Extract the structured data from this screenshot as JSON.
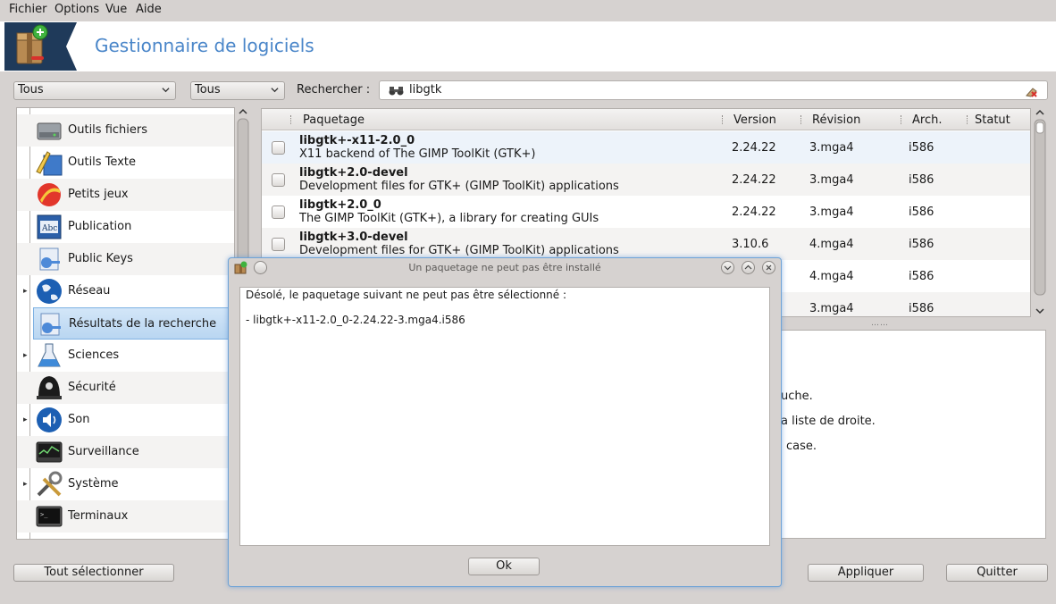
{
  "menubar": {
    "items": [
      "Fichier",
      "Options",
      "Vue",
      "Aide"
    ]
  },
  "banner": {
    "title": "Gestionnaire de logiciels"
  },
  "filters": {
    "combo1": "Tous",
    "combo2": "Tous",
    "search_label": "Rechercher :",
    "search_value": "libgtk"
  },
  "categories": [
    {
      "label": "Outils fichiers",
      "icon": "harddisk-icon",
      "expander": false
    },
    {
      "label": "Outils Texte",
      "icon": "text-tools-icon",
      "expander": false
    },
    {
      "label": "Petits jeux",
      "icon": "ball-icon",
      "expander": false
    },
    {
      "label": "Publication",
      "icon": "book-abc-icon",
      "expander": false
    },
    {
      "label": "Public Keys",
      "icon": "public-keys-icon",
      "expander": false
    },
    {
      "label": "Réseau",
      "icon": "globe-icon",
      "expander": true
    },
    {
      "label": "Résultats de la recherche",
      "icon": "search-results-icon",
      "expander": false,
      "selected": true
    },
    {
      "label": "Sciences",
      "icon": "flask-icon",
      "expander": true
    },
    {
      "label": "Sécurité",
      "icon": "police-helmet-icon",
      "expander": false
    },
    {
      "label": "Son",
      "icon": "speaker-icon",
      "expander": true
    },
    {
      "label": "Surveillance",
      "icon": "monitor-graph-icon",
      "expander": false
    },
    {
      "label": "Système",
      "icon": "tools-icon",
      "expander": true
    },
    {
      "label": "Terminaux",
      "icon": "terminal-icon",
      "expander": false
    }
  ],
  "packages": {
    "columns": {
      "name": "Paquetage",
      "version": "Version",
      "release": "Révision",
      "arch": "Arch.",
      "status": "Statut"
    },
    "rows": [
      {
        "name": "libgtk+-x11-2.0_0",
        "desc": "X11 backend of The GIMP ToolKit (GTK+)",
        "version": "2.24.22",
        "release": "3.mga4",
        "arch": "i586"
      },
      {
        "name": "libgtk+2.0-devel",
        "desc": "Development files for GTK+ (GIMP ToolKit) applications",
        "version": "2.24.22",
        "release": "3.mga4",
        "arch": "i586"
      },
      {
        "name": "libgtk+2.0_0",
        "desc": "The GIMP ToolKit (GTK+), a library for creating GUIs",
        "version": "2.24.22",
        "release": "3.mga4",
        "arch": "i586"
      },
      {
        "name": "libgtk+3.0-devel",
        "desc": "Development files for GTK+ (GIMP ToolKit) applications",
        "version": "3.10.6",
        "release": "4.mga4",
        "arch": "i586"
      },
      {
        "name": "",
        "desc": "",
        "version": "",
        "release": "4.mga4",
        "arch": "i586"
      },
      {
        "name": "",
        "desc": "",
        "version": "",
        "release": "3.mga4",
        "arch": "i586"
      }
    ]
  },
  "info_panel": {
    "lines": [
      "uche.",
      "a liste de droite.",
      "case."
    ]
  },
  "buttons": {
    "select_all": "Tout sélectionner",
    "apply": "Appliquer",
    "quit": "Quitter"
  },
  "dialog": {
    "title": "Un paquetage ne peut pas être installé",
    "message": "Désolé, le paquetage suivant ne peut pas être sélectionné :",
    "package": "- libgtk+-x11-2.0_0-2.24.22-3.mga4.i586",
    "ok": "Ok"
  },
  "colors": {
    "accent": "#4a86c9",
    "selection": "#b9d6f1",
    "window_bg": "#d6d2d0"
  }
}
